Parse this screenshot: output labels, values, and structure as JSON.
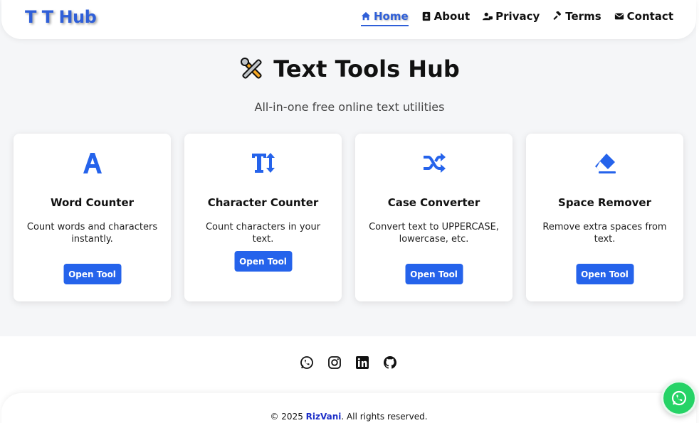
{
  "brand": "T T Hub",
  "nav": {
    "home": "Home",
    "about": "About",
    "privacy": "Privacy",
    "terms": "Terms",
    "contact": "Contact"
  },
  "hero": {
    "title": "Text Tools Hub",
    "subtitle": "All-in-one free online text utilities"
  },
  "tools": [
    {
      "icon": "font-a-icon",
      "title": "Word Counter",
      "description": "Count words and characters instantly.",
      "button": "Open Tool"
    },
    {
      "icon": "text-height-icon",
      "title": "Character Counter",
      "description": "Count characters in your text.",
      "button": "Open Tool"
    },
    {
      "icon": "shuffle-icon",
      "title": "Case Converter",
      "description": "Convert text to UPPERCASE, lowercase, etc.",
      "button": "Open Tool"
    },
    {
      "icon": "eraser-icon",
      "title": "Space Remover",
      "description": "Remove extra spaces from text.",
      "button": "Open Tool"
    }
  ],
  "social": [
    "whatsapp-icon",
    "instagram-icon",
    "linkedin-icon",
    "github-icon"
  ],
  "footer": {
    "prefix": "© 2025 ",
    "author": "RizVani",
    "suffix": ". All rights reserved."
  },
  "colors": {
    "accent": "#2563eb",
    "brand": "#2f5fd8",
    "whatsapp": "#25d366"
  }
}
